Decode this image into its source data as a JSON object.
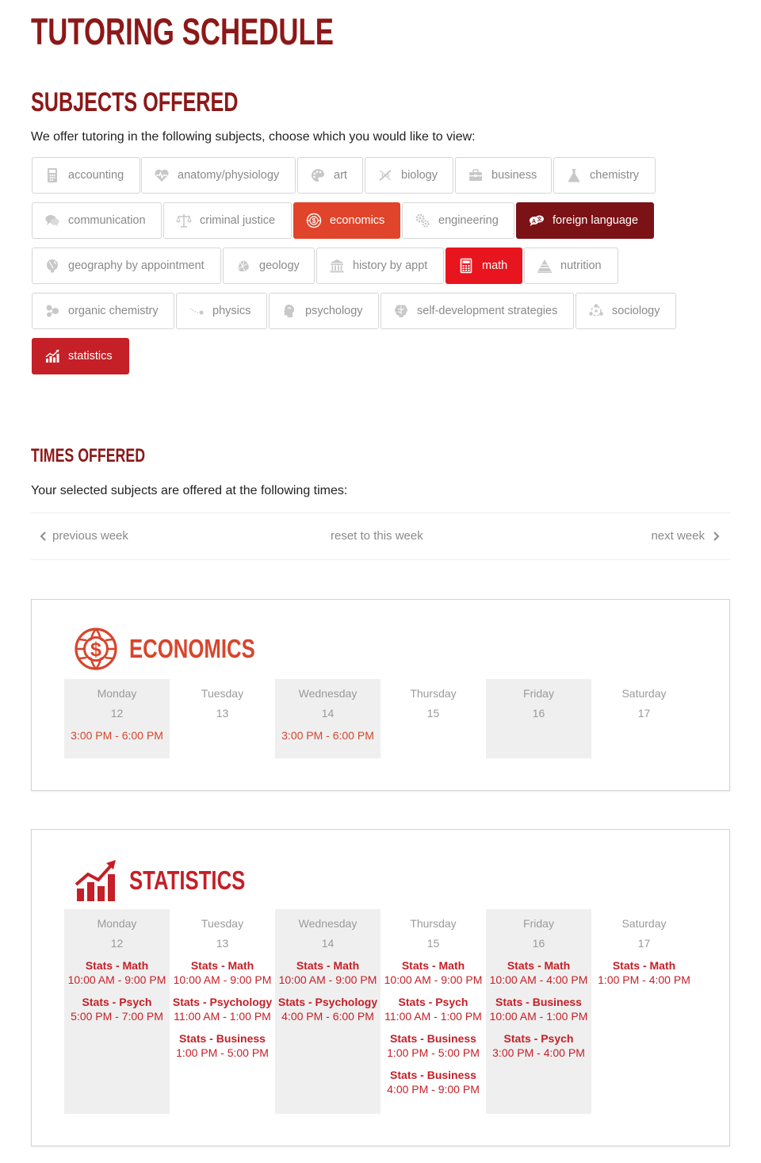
{
  "page": {
    "title": "TUTORING SCHEDULE",
    "subjects_title": "SUBJECTS OFFERED",
    "subjects_intro": "We offer tutoring in the following subjects, choose which you would like to view:",
    "times_title": "TIMES OFFERED",
    "times_intro": "Your selected subjects are offered at the following times:"
  },
  "colors": {
    "title": "#8c1818",
    "economics": "#e0442a",
    "foreign_language": "#7b1216",
    "math": "#e8151f",
    "statistics": "#c51f27",
    "inactive_text": "#8a8a8a"
  },
  "subjects": [
    {
      "label": "accounting",
      "icon": "abacus-icon",
      "active": false
    },
    {
      "label": "anatomy/physiology",
      "icon": "heart-pulse-icon",
      "active": false
    },
    {
      "label": "art",
      "icon": "palette-icon",
      "active": false
    },
    {
      "label": "biology",
      "icon": "dna-icon",
      "active": false
    },
    {
      "label": "business",
      "icon": "briefcase-icon",
      "active": false
    },
    {
      "label": "chemistry",
      "icon": "flask-icon",
      "active": false
    },
    {
      "label": "communication",
      "icon": "speech-bubbles-icon",
      "active": false
    },
    {
      "label": "criminal justice",
      "icon": "scales-icon",
      "active": false
    },
    {
      "label": "economics",
      "icon": "globe-dollar-icon",
      "active": true
    },
    {
      "label": "engineering",
      "icon": "gears-icon",
      "active": false
    },
    {
      "label": "foreign language",
      "icon": "translate-bubbles-icon",
      "active": true
    },
    {
      "label": "geography by appointment",
      "icon": "globe-icon",
      "active": false
    },
    {
      "label": "geology",
      "icon": "rock-icon",
      "active": false
    },
    {
      "label": "history by appt",
      "icon": "museum-icon",
      "active": false
    },
    {
      "label": "math",
      "icon": "calculator-icon",
      "active": true
    },
    {
      "label": "nutrition",
      "icon": "food-pyramid-icon",
      "active": false
    },
    {
      "label": "organic chemistry",
      "icon": "molecule-icon",
      "active": false
    },
    {
      "label": "physics",
      "icon": "projectile-icon",
      "active": false
    },
    {
      "label": "psychology",
      "icon": "head-icon",
      "active": false
    },
    {
      "label": "self-development strategies",
      "icon": "brain-icon",
      "active": false
    },
    {
      "label": "sociology",
      "icon": "people-network-icon",
      "active": false
    },
    {
      "label": "statistics",
      "icon": "bar-chart-up-icon",
      "active": true
    }
  ],
  "week_nav": {
    "previous": "previous week",
    "reset": "reset to this week",
    "next": "next week"
  },
  "schedules": {
    "economics": {
      "title": "ECONOMICS",
      "icon": "globe-dollar-icon",
      "days": [
        {
          "name": "Monday",
          "num": "12",
          "slots": [
            {
              "name": "",
              "time": "3:00 PM - 6:00 PM"
            }
          ]
        },
        {
          "name": "Tuesday",
          "num": "13",
          "slots": []
        },
        {
          "name": "Wednesday",
          "num": "14",
          "slots": [
            {
              "name": "",
              "time": "3:00 PM - 6:00 PM"
            }
          ]
        },
        {
          "name": "Thursday",
          "num": "15",
          "slots": []
        },
        {
          "name": "Friday",
          "num": "16",
          "slots": []
        },
        {
          "name": "Saturday",
          "num": "17",
          "slots": []
        }
      ]
    },
    "statistics": {
      "title": "STATISTICS",
      "icon": "bar-chart-up-icon",
      "days": [
        {
          "name": "Monday",
          "num": "12",
          "slots": [
            {
              "name": "Stats - Math",
              "time": "10:00 AM - 9:00 PM"
            },
            {
              "name": "Stats - Psych",
              "time": "5:00 PM - 7:00 PM"
            }
          ]
        },
        {
          "name": "Tuesday",
          "num": "13",
          "slots": [
            {
              "name": "Stats - Math",
              "time": "10:00 AM - 9:00 PM"
            },
            {
              "name": "Stats - Psychology",
              "time": "11:00 AM - 1:00 PM"
            },
            {
              "name": "Stats - Business",
              "time": "1:00 PM - 5:00 PM"
            }
          ]
        },
        {
          "name": "Wednesday",
          "num": "14",
          "slots": [
            {
              "name": "Stats - Math",
              "time": "10:00 AM - 9:00 PM"
            },
            {
              "name": "Stats - Psychology",
              "time": "4:00 PM - 6:00 PM"
            }
          ]
        },
        {
          "name": "Thursday",
          "num": "15",
          "slots": [
            {
              "name": "Stats - Math",
              "time": "10:00 AM - 9:00 PM"
            },
            {
              "name": "Stats - Psych",
              "time": "11:00 AM - 1:00 PM"
            },
            {
              "name": "Stats - Business",
              "time": "1:00 PM - 5:00 PM"
            },
            {
              "name": "Stats - Business",
              "time": "4:00 PM - 9:00 PM"
            }
          ]
        },
        {
          "name": "Friday",
          "num": "16",
          "slots": [
            {
              "name": "Stats - Math",
              "time": "10:00 AM - 4:00 PM"
            },
            {
              "name": "Stats - Business",
              "time": "10:00 AM - 1:00 PM"
            },
            {
              "name": "Stats - Psych",
              "time": "3:00 PM - 4:00 PM"
            }
          ]
        },
        {
          "name": "Saturday",
          "num": "17",
          "slots": [
            {
              "name": "Stats - Math",
              "time": "1:00 PM - 4:00 PM"
            }
          ]
        }
      ]
    }
  }
}
